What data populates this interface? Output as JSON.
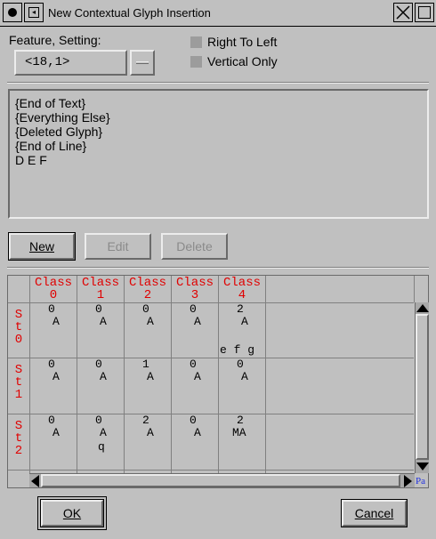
{
  "window": {
    "title": "New Contextual Glyph Insertion"
  },
  "feature": {
    "label": "Feature, Setting:",
    "value": "<18,1>",
    "menu_button_label": "",
    "right_to_left_label": "Right To Left",
    "vertical_only_label": "Vertical Only"
  },
  "classes_text": [
    "{End of Text}",
    "{Everything Else}",
    "{Deleted Glyph}",
    "{End of Line}",
    "D E F"
  ],
  "buttons": {
    "new": "New",
    "edit": "Edit",
    "delete": "Delete",
    "ok": "OK",
    "cancel": "Cancel"
  },
  "state_table": {
    "columns": [
      {
        "word": "Class",
        "num": "0"
      },
      {
        "word": "Class",
        "num": "1"
      },
      {
        "word": "Class",
        "num": "2"
      },
      {
        "word": "Class",
        "num": "3"
      },
      {
        "word": "Class",
        "num": "4"
      }
    ],
    "rows": [
      {
        "label": [
          "S",
          "t",
          "0"
        ],
        "cells": [
          {
            "state": "0",
            "flag": "A",
            "extra": ""
          },
          {
            "state": "0",
            "flag": "A",
            "extra": ""
          },
          {
            "state": "0",
            "flag": "A",
            "extra": ""
          },
          {
            "state": "0",
            "flag": "A",
            "extra": ""
          },
          {
            "state": "2",
            "flag": "A",
            "extra": "e f g"
          }
        ]
      },
      {
        "label": [
          "S",
          "t",
          "1"
        ],
        "cells": [
          {
            "state": "0",
            "flag": "A",
            "extra": ""
          },
          {
            "state": "0",
            "flag": "A",
            "extra": ""
          },
          {
            "state": "1",
            "flag": "A",
            "extra": ""
          },
          {
            "state": "0",
            "flag": "A",
            "extra": ""
          },
          {
            "state": "0",
            "flag": "A",
            "extra": ""
          }
        ]
      },
      {
        "label": [
          "S",
          "t",
          "2"
        ],
        "cells": [
          {
            "state": "0",
            "flag": "A",
            "extra": ""
          },
          {
            "state": "0",
            "flag": "A",
            "extra": "q"
          },
          {
            "state": "2",
            "flag": "A",
            "extra": ""
          },
          {
            "state": "0",
            "flag": "A",
            "extra": ""
          },
          {
            "state": "2",
            "flag": "MA",
            "extra": ""
          }
        ]
      }
    ],
    "corner_glyph": "Pa"
  }
}
